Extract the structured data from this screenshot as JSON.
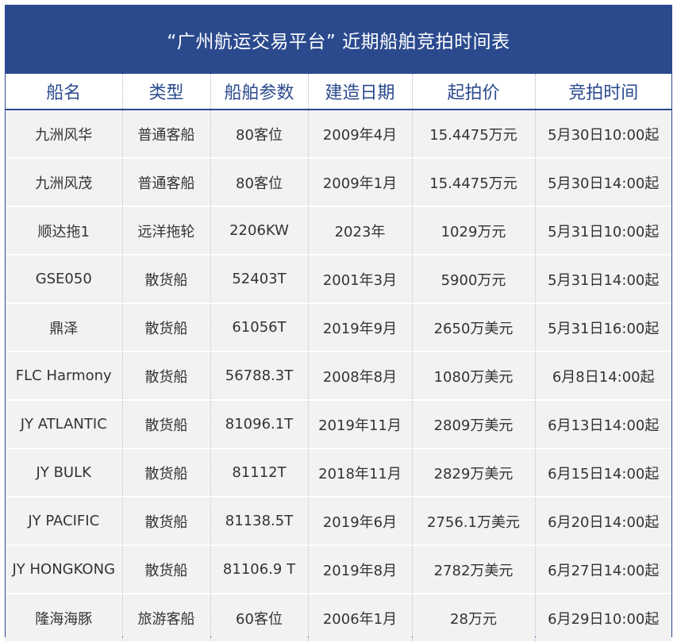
{
  "title": "“广州航运交易平台” 近期船舶竞拍时间表",
  "columns": [
    "船名",
    "类型",
    "船舶参数",
    "建造日期",
    "起拍价",
    "竞拍时间"
  ],
  "rows": [
    [
      "九洲风华",
      "普通客船",
      "80客位",
      "2009年4月",
      "15.4475万元",
      "5月30日10:00起"
    ],
    [
      "九洲风茂",
      "普通客船",
      "80客位",
      "2009年1月",
      "15.4475万元",
      "5月30日14:00起"
    ],
    [
      "顺达拖1",
      "远洋拖轮",
      "2206KW",
      "2023年",
      "1029万元",
      "5月31日10:00起"
    ],
    [
      "GSE050",
      "散货船",
      "52403T",
      "2001年3月",
      "5900万元",
      "5月31日14:00起"
    ],
    [
      "鼎泽",
      "散货船",
      "61056T",
      "2019年9月",
      "2650万美元",
      "5月31日16:00起"
    ],
    [
      "FLC Harmony",
      "散货船",
      "56788.3T",
      "2008年8月",
      "1080万美元",
      "6月8日14:00起"
    ],
    [
      "JY ATLANTIC",
      "散货船",
      "81096.1T",
      "2019年11月",
      "2809万美元",
      "6月13日14:00起"
    ],
    [
      "JY BULK",
      "散货船",
      "81112T",
      "2018年11月",
      "2829万美元",
      "6月15日14:00起"
    ],
    [
      "JY PACIFIC",
      "散货船",
      "81138.5T",
      "2019年6月",
      "2756.1万美元",
      "6月20日14:00起"
    ],
    [
      "JY HONGKONG",
      "散货船",
      "81106.9 T",
      "2019年8月",
      "2782万美元",
      "6月27日14:00起"
    ],
    [
      "隆海海豚",
      "旅游客船",
      "60客位",
      "2006年1月",
      "28万元",
      "6月29日10:00起"
    ]
  ]
}
